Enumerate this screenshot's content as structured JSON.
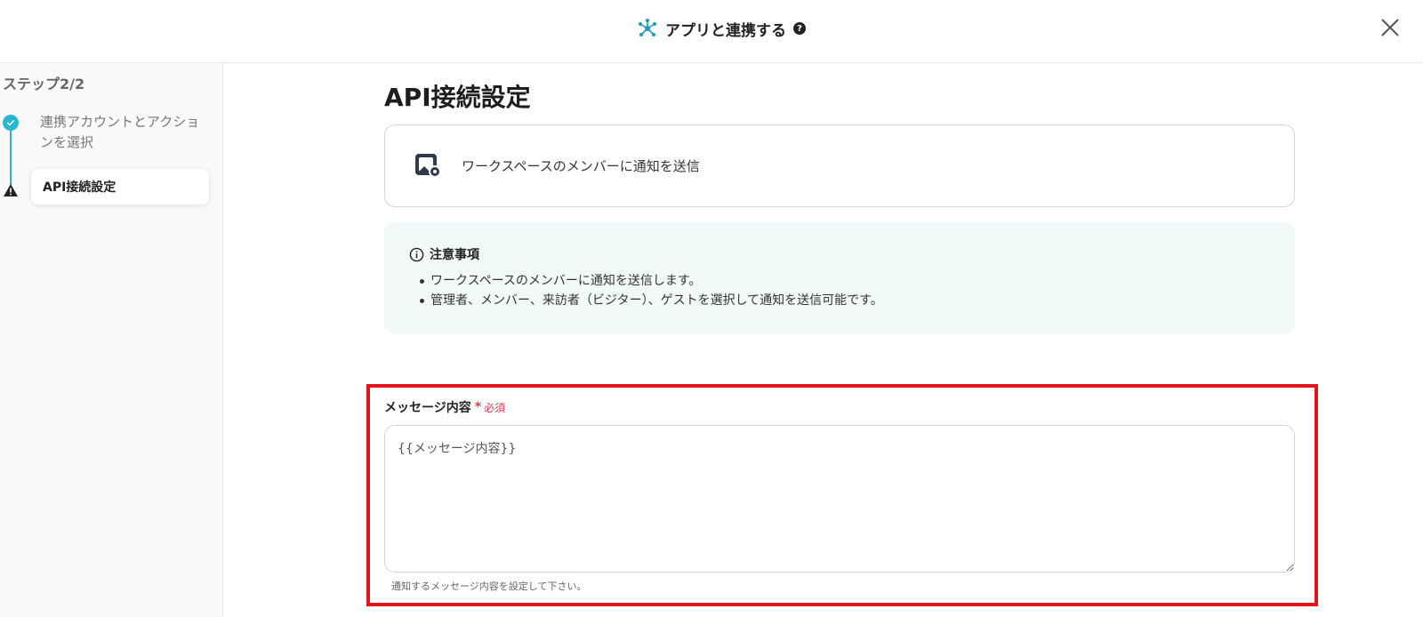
{
  "header": {
    "title": "アプリと連携する",
    "help_symbol": "?"
  },
  "sidebar": {
    "step_label": "ステップ2/2",
    "steps": [
      {
        "label": "連携アカウントとアクションを選択",
        "status": "completed"
      },
      {
        "label": "API接続設定",
        "status": "current"
      }
    ]
  },
  "main": {
    "title": "API接続設定",
    "action_card": {
      "label": "ワークスペースのメンバーに通知を送信"
    },
    "notice": {
      "heading": "注意事項",
      "items": [
        "ワークスペースのメンバーに通知を送信します。",
        "管理者、メンバー、来訪者（ビジター）、ゲストを選択して通知を送信可能です。"
      ]
    },
    "message_field": {
      "label": "メッセージ内容",
      "required_mark": "*",
      "required_text": "必須",
      "value": "{{メッセージ内容}}",
      "helper": "通知するメッセージ内容を設定して下さい。"
    }
  },
  "colors": {
    "accent": "#27b8cf",
    "highlight": "#e3151b",
    "required": "#e8344a"
  }
}
